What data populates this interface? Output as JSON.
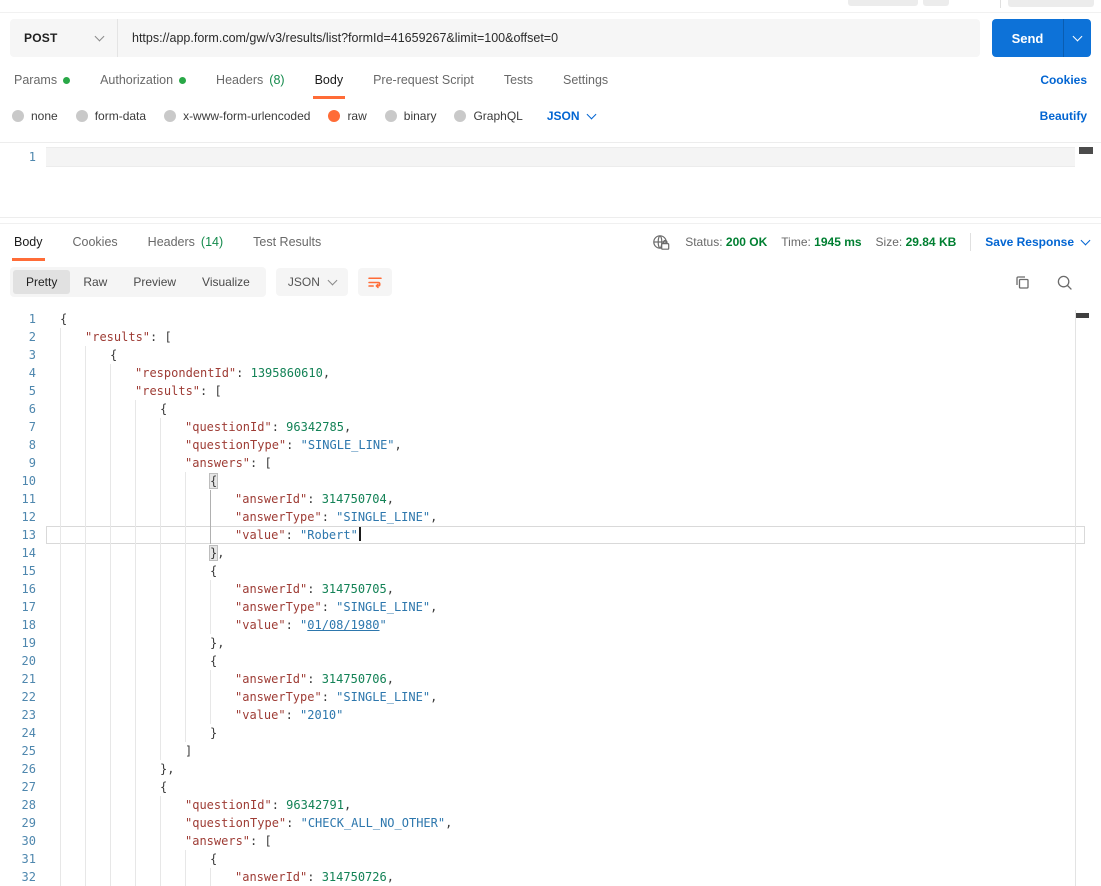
{
  "colors": {
    "accent_orange": "#ff6c37",
    "link_blue": "#0265d2",
    "send_button_blue": "#0d72d8",
    "status_green": "#007f31",
    "indicator_dot_green": "#29a847"
  },
  "request": {
    "method": "POST",
    "url": "https://app.form.com/gw/v3/results/list?formId=41659267&limit=100&offset=0",
    "send_label": "Send",
    "cookies_link": "Cookies",
    "beautify_link": "Beautify",
    "body_language": "JSON",
    "editor_line_number": "1",
    "tabs": [
      {
        "label": "Params",
        "dot": true
      },
      {
        "label": "Authorization",
        "dot": true
      },
      {
        "label": "Headers",
        "count": "(8)"
      },
      {
        "label": "Body",
        "active": true
      },
      {
        "label": "Pre-request Script"
      },
      {
        "label": "Tests"
      },
      {
        "label": "Settings"
      }
    ],
    "body_modes": [
      {
        "label": "none"
      },
      {
        "label": "form-data"
      },
      {
        "label": "x-www-form-urlencoded"
      },
      {
        "label": "raw",
        "selected": true
      },
      {
        "label": "binary"
      },
      {
        "label": "GraphQL"
      }
    ]
  },
  "response": {
    "tabs": [
      {
        "label": "Body",
        "active": true
      },
      {
        "label": "Cookies"
      },
      {
        "label": "Headers",
        "count": "(14)"
      },
      {
        "label": "Test Results"
      }
    ],
    "status_label": "Status:",
    "status_value": "200 OK",
    "time_label": "Time:",
    "time_value": "1945 ms",
    "size_label": "Size:",
    "size_value": "29.84 KB",
    "save_response_label": "Save Response",
    "view_tabs": [
      {
        "label": "Pretty",
        "active": true
      },
      {
        "label": "Raw"
      },
      {
        "label": "Preview"
      },
      {
        "label": "Visualize"
      }
    ],
    "view_language": "JSON",
    "code_lines": [
      {
        "n": 1,
        "i": 0,
        "t": [
          [
            "p",
            "{"
          ]
        ]
      },
      {
        "n": 2,
        "i": 1,
        "t": [
          [
            "k",
            "\"results\""
          ],
          [
            "p",
            ": ["
          ]
        ]
      },
      {
        "n": 3,
        "i": 2,
        "t": [
          [
            "p",
            "{"
          ]
        ]
      },
      {
        "n": 4,
        "i": 3,
        "t": [
          [
            "k",
            "\"respondentId\""
          ],
          [
            "p",
            ": "
          ],
          [
            "n",
            "1395860610"
          ],
          [
            "p",
            ","
          ]
        ]
      },
      {
        "n": 5,
        "i": 3,
        "t": [
          [
            "k",
            "\"results\""
          ],
          [
            "p",
            ": ["
          ]
        ]
      },
      {
        "n": 6,
        "i": 4,
        "t": [
          [
            "p",
            "{"
          ]
        ]
      },
      {
        "n": 7,
        "i": 5,
        "t": [
          [
            "k",
            "\"questionId\""
          ],
          [
            "p",
            ": "
          ],
          [
            "n",
            "96342785"
          ],
          [
            "p",
            ","
          ]
        ]
      },
      {
        "n": 8,
        "i": 5,
        "t": [
          [
            "k",
            "\"questionType\""
          ],
          [
            "p",
            ": "
          ],
          [
            "s",
            "\"SINGLE_LINE\""
          ],
          [
            "p",
            ","
          ]
        ]
      },
      {
        "n": 9,
        "i": 5,
        "t": [
          [
            "k",
            "\"answers\""
          ],
          [
            "p",
            ": ["
          ]
        ]
      },
      {
        "n": 10,
        "i": 6,
        "t": [
          [
            "m",
            "{"
          ]
        ]
      },
      {
        "n": 11,
        "i": 7,
        "ag": true,
        "t": [
          [
            "k",
            "\"answerId\""
          ],
          [
            "p",
            ": "
          ],
          [
            "n",
            "314750704"
          ],
          [
            "p",
            ","
          ]
        ]
      },
      {
        "n": 12,
        "i": 7,
        "ag": true,
        "t": [
          [
            "k",
            "\"answerType\""
          ],
          [
            "p",
            ": "
          ],
          [
            "s",
            "\"SINGLE_LINE\""
          ],
          [
            "p",
            ","
          ]
        ]
      },
      {
        "n": 13,
        "i": 7,
        "ag": true,
        "cur": true,
        "cursor": true,
        "t": [
          [
            "k",
            "\"value\""
          ],
          [
            "p",
            ": "
          ],
          [
            "s",
            "\"Robert\""
          ]
        ]
      },
      {
        "n": 14,
        "i": 6,
        "t": [
          [
            "m",
            "}"
          ],
          [
            "p",
            ","
          ]
        ]
      },
      {
        "n": 15,
        "i": 6,
        "t": [
          [
            "p",
            "{"
          ]
        ]
      },
      {
        "n": 16,
        "i": 7,
        "t": [
          [
            "k",
            "\"answerId\""
          ],
          [
            "p",
            ": "
          ],
          [
            "n",
            "314750705"
          ],
          [
            "p",
            ","
          ]
        ]
      },
      {
        "n": 17,
        "i": 7,
        "t": [
          [
            "k",
            "\"answerType\""
          ],
          [
            "p",
            ": "
          ],
          [
            "s",
            "\"SINGLE_LINE\""
          ],
          [
            "p",
            ","
          ]
        ]
      },
      {
        "n": 18,
        "i": 7,
        "t": [
          [
            "k",
            "\"value\""
          ],
          [
            "p",
            ": "
          ],
          [
            "s",
            "\""
          ],
          [
            "u",
            "01/08/1980"
          ],
          [
            "s",
            "\""
          ]
        ]
      },
      {
        "n": 19,
        "i": 6,
        "t": [
          [
            "p",
            "},"
          ]
        ]
      },
      {
        "n": 20,
        "i": 6,
        "t": [
          [
            "p",
            "{"
          ]
        ]
      },
      {
        "n": 21,
        "i": 7,
        "t": [
          [
            "k",
            "\"answerId\""
          ],
          [
            "p",
            ": "
          ],
          [
            "n",
            "314750706"
          ],
          [
            "p",
            ","
          ]
        ]
      },
      {
        "n": 22,
        "i": 7,
        "t": [
          [
            "k",
            "\"answerType\""
          ],
          [
            "p",
            ": "
          ],
          [
            "s",
            "\"SINGLE_LINE\""
          ],
          [
            "p",
            ","
          ]
        ]
      },
      {
        "n": 23,
        "i": 7,
        "t": [
          [
            "k",
            "\"value\""
          ],
          [
            "p",
            ": "
          ],
          [
            "s",
            "\"2010\""
          ]
        ]
      },
      {
        "n": 24,
        "i": 6,
        "t": [
          [
            "p",
            "}"
          ]
        ]
      },
      {
        "n": 25,
        "i": 5,
        "t": [
          [
            "p",
            "]"
          ]
        ]
      },
      {
        "n": 26,
        "i": 4,
        "t": [
          [
            "p",
            "},"
          ]
        ]
      },
      {
        "n": 27,
        "i": 4,
        "t": [
          [
            "p",
            "{"
          ]
        ]
      },
      {
        "n": 28,
        "i": 5,
        "t": [
          [
            "k",
            "\"questionId\""
          ],
          [
            "p",
            ": "
          ],
          [
            "n",
            "96342791"
          ],
          [
            "p",
            ","
          ]
        ]
      },
      {
        "n": 29,
        "i": 5,
        "t": [
          [
            "k",
            "\"questionType\""
          ],
          [
            "p",
            ": "
          ],
          [
            "s",
            "\"CHECK_ALL_NO_OTHER\""
          ],
          [
            "p",
            ","
          ]
        ]
      },
      {
        "n": 30,
        "i": 5,
        "t": [
          [
            "k",
            "\"answers\""
          ],
          [
            "p",
            ": ["
          ]
        ]
      },
      {
        "n": 31,
        "i": 6,
        "t": [
          [
            "p",
            "{"
          ]
        ]
      },
      {
        "n": 32,
        "i": 7,
        "t": [
          [
            "k",
            "\"answerId\""
          ],
          [
            "p",
            ": "
          ],
          [
            "n",
            "314750726"
          ],
          [
            "p",
            ","
          ]
        ]
      }
    ]
  }
}
